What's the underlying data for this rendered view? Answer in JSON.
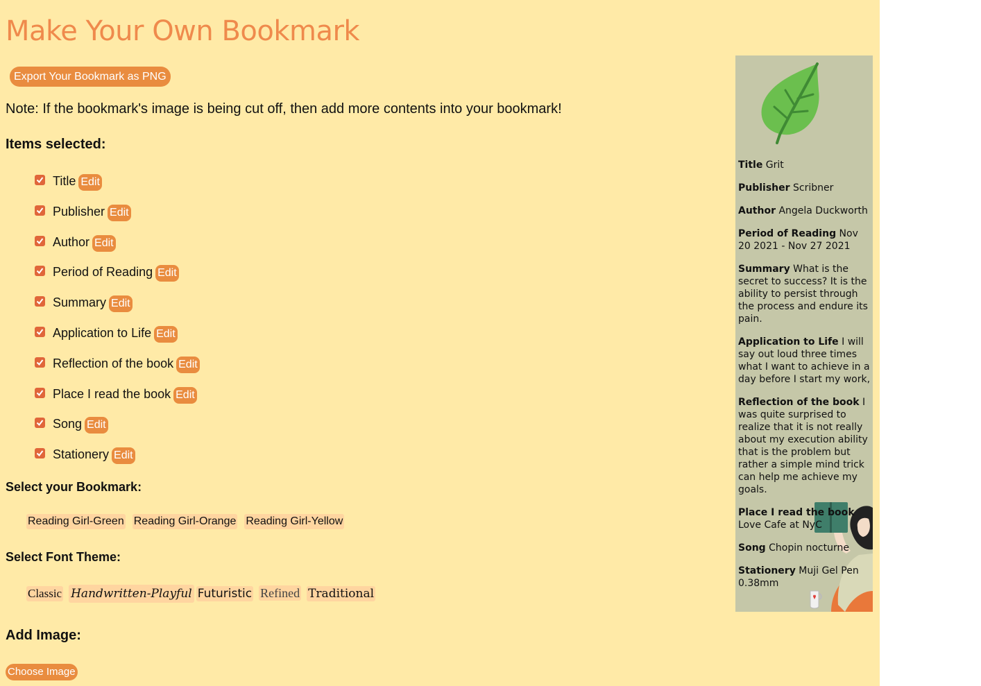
{
  "app": {
    "title": "Make Your Own Bookmark"
  },
  "toolbar": {
    "export_label": "Export Your Bookmark as PNG"
  },
  "note": "Note: If the bookmark's image is being cut off, then add more contents into your bookmark!",
  "items_section": {
    "heading": "Items selected:",
    "edit_label": "Edit",
    "items": [
      {
        "label": "Title",
        "checked": true
      },
      {
        "label": "Publisher",
        "checked": true
      },
      {
        "label": "Author",
        "checked": true
      },
      {
        "label": "Period of Reading",
        "checked": true
      },
      {
        "label": "Summary",
        "checked": true
      },
      {
        "label": "Application to Life",
        "checked": true
      },
      {
        "label": "Reflection of the book",
        "checked": true
      },
      {
        "label": "Place I read the book",
        "checked": true
      },
      {
        "label": "Song",
        "checked": true
      },
      {
        "label": "Stationery",
        "checked": true
      }
    ]
  },
  "bookmark_section": {
    "heading": "Select your Bookmark:",
    "options": [
      "Reading Girl-Green",
      "Reading Girl-Orange",
      "Reading Girl-Yellow"
    ]
  },
  "font_section": {
    "heading": "Select Font Theme:",
    "options": [
      "Classic",
      "Handwritten-Playful",
      "Futuristic",
      "Refined",
      "Traditional"
    ]
  },
  "image_section": {
    "heading": "Add Image:",
    "choose_label": "Choose Image"
  },
  "preview": {
    "fields": [
      {
        "label": "Title",
        "value": "Grit"
      },
      {
        "label": "Publisher",
        "value": "Scribner"
      },
      {
        "label": "Author",
        "value": "Angela Duckworth"
      },
      {
        "label": "Period of Reading",
        "value": "Nov 20 2021 - Nov 27 2021"
      },
      {
        "label": "Summary",
        "value": "What is the secret to success? It is the ability to persist through the process and endure its pain."
      },
      {
        "label": "Application to Life",
        "value": "I will say out loud three times what I want to achieve in a day before I start my work,"
      },
      {
        "label": "Reflection of the book",
        "value": "I was quite surprised to realize that it is not really about my execution ability that is the problem but rather a simple mind trick can help me achieve my goals."
      },
      {
        "label": "Place I read the book",
        "value": "Love Cafe at NyC"
      },
      {
        "label": "Song",
        "value": "Chopin nocturne"
      },
      {
        "label": "Stationery",
        "value": "Muji Gel Pen 0.38mm"
      }
    ],
    "images": [
      "leaf-image",
      "reading-girl-image"
    ]
  },
  "colors": {
    "page_bg": "#ffeaa7",
    "accent": "#e98c3f",
    "title": "#ef8a4c",
    "chip_bg": "#ffd5a0",
    "checkbox": "#e0663a",
    "preview_bg": "#c5c7a8"
  }
}
